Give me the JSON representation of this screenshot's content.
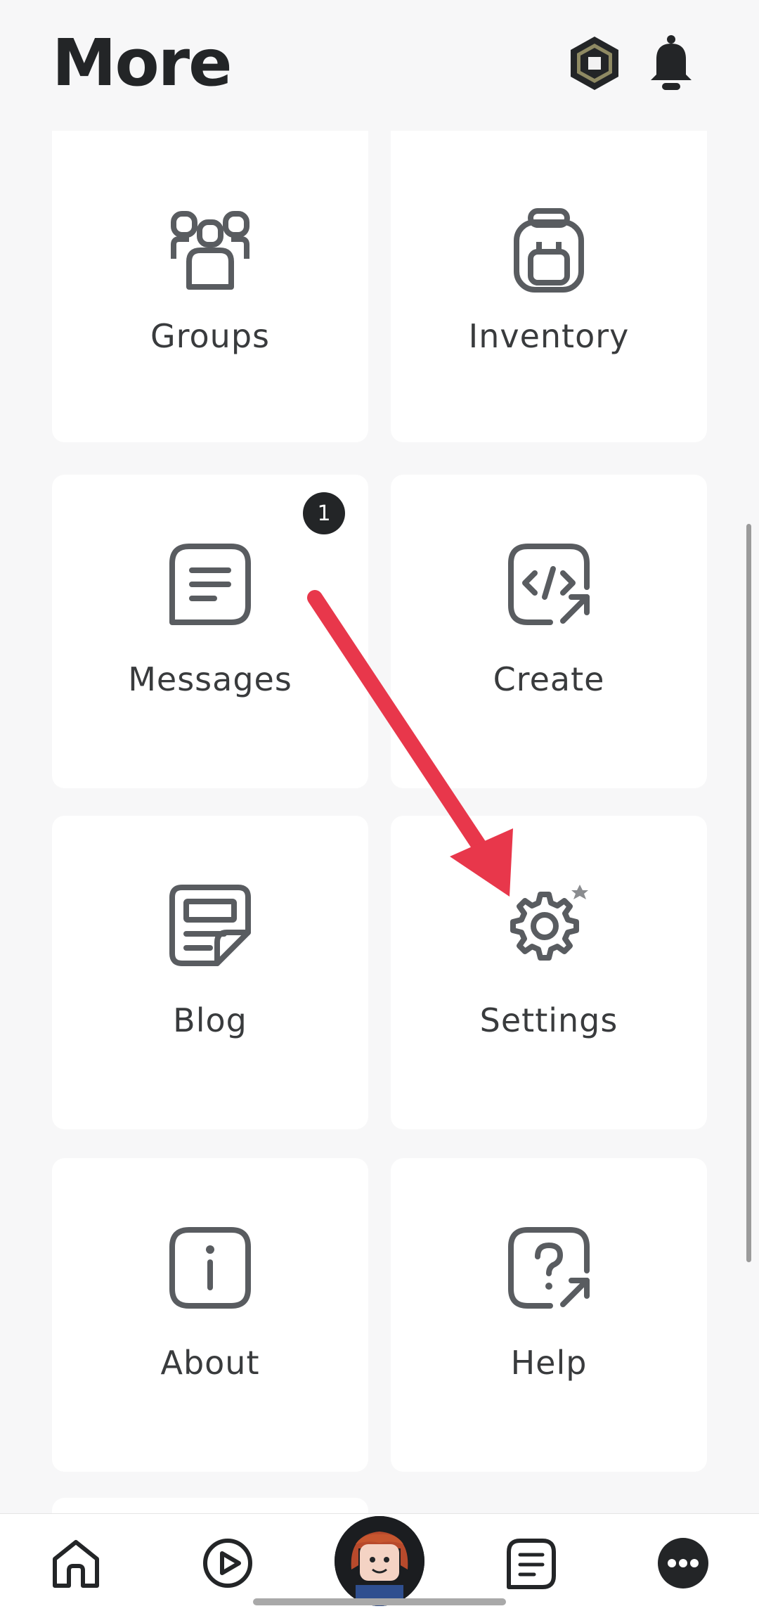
{
  "header": {
    "title": "More",
    "robux_icon": "robux-icon",
    "bell_icon": "bell-icon"
  },
  "tiles": [
    {
      "label": "Groups",
      "icon": "groups-icon"
    },
    {
      "label": "Inventory",
      "icon": "backpack-icon"
    },
    {
      "label": "Messages",
      "icon": "messages-icon",
      "badge": "1"
    },
    {
      "label": "Create",
      "icon": "create-code-icon"
    },
    {
      "label": "Blog",
      "icon": "blog-icon"
    },
    {
      "label": "Settings",
      "icon": "settings-gear-icon"
    },
    {
      "label": "About",
      "icon": "info-icon"
    },
    {
      "label": "Help",
      "icon": "help-icon"
    }
  ],
  "nav": {
    "items": [
      "home-icon",
      "play-icon",
      "avatar",
      "chat-icon",
      "more-icon"
    ]
  },
  "colors": {
    "background": "#f7f7f8",
    "tile": "#ffffff",
    "icon": "#595c60",
    "annotation_arrow": "#e8374b"
  }
}
